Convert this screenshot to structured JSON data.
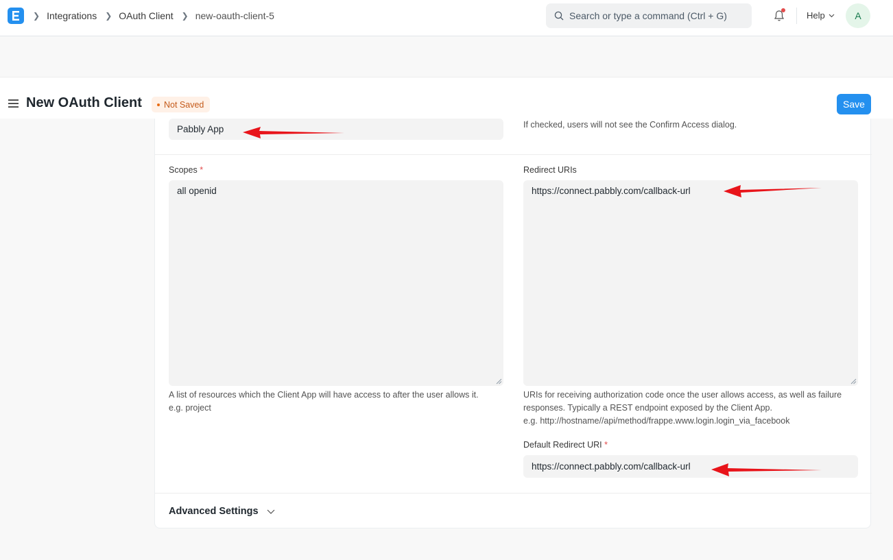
{
  "navbar": {
    "logo_letter": "E",
    "breadcrumbs": [
      "Integrations",
      "OAuth Client",
      "new-oauth-client-5"
    ],
    "search_placeholder": "Search or type a command (Ctrl + G)",
    "help_label": "Help",
    "avatar_initial": "A"
  },
  "page": {
    "title": "New OAuth Client",
    "status": "Not Saved",
    "save_label": "Save"
  },
  "form": {
    "app_name_value": "Pabbly App",
    "skip_authorization_help": "If checked, users will not see the Confirm Access dialog.",
    "scopes_label": "Scopes",
    "scopes_required": "*",
    "scopes_value": "all openid",
    "scopes_help": "A list of resources which the Client App will have access to after the user allows it.",
    "scopes_example": "e.g. project",
    "redirect_uris_label": "Redirect URIs",
    "redirect_uris_value": "https://connect.pabbly.com/callback-url",
    "redirect_uris_help_1": "URIs for receiving authorization code once the user allows access, as well as failure",
    "redirect_uris_help_2": "responses. Typically a REST endpoint exposed by the Client App.",
    "redirect_uris_example": "e.g. http://hostname//api/method/frappe.www.login.login_via_facebook",
    "default_redirect_label": "Default Redirect URI",
    "default_redirect_required": "*",
    "default_redirect_value": "https://connect.pabbly.com/callback-url",
    "advanced_settings_label": "Advanced Settings"
  },
  "icons": {
    "logo": "erpnext-logo-icon",
    "search": "search-icon",
    "notifications": "bell-icon",
    "help_dropdown": "chevron-down-icon",
    "sidebar_toggle": "hamburger-icon",
    "advanced_toggle": "chevron-down-icon",
    "annotation": "red-arrow-icon"
  },
  "colors": {
    "primary": "#2490ef",
    "status_bg": "#fff1e7",
    "status_text": "#c45a1a",
    "annotation_arrow": "#e8141a"
  }
}
